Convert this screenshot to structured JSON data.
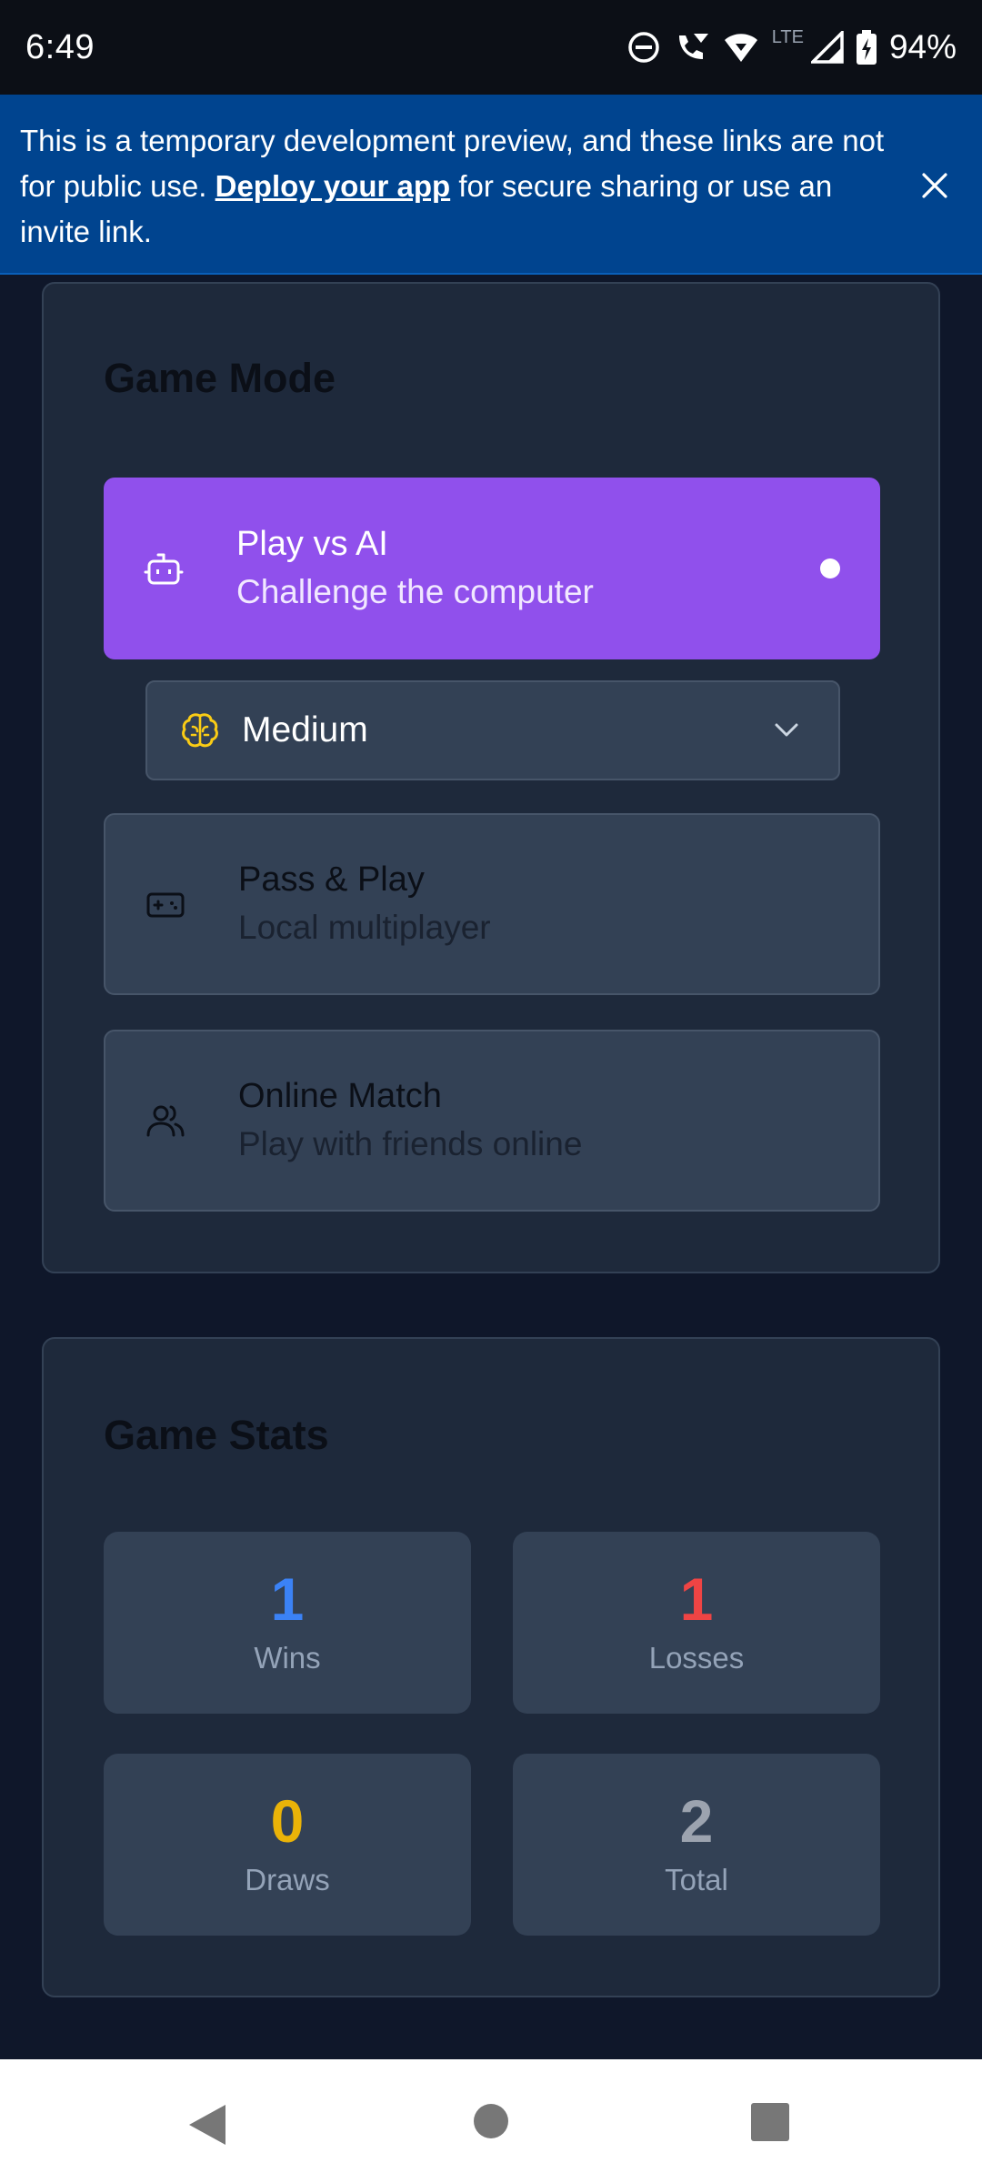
{
  "status_bar": {
    "time": "6:49",
    "network": "LTE",
    "battery": "94%"
  },
  "banner": {
    "text_before": "This is a temporary development preview, and these links are not for public use. ",
    "link": "Deploy your app",
    "text_after": " for secure sharing or use an invite link."
  },
  "game_mode": {
    "title": "Game Mode",
    "options": [
      {
        "title": "Play vs AI",
        "subtitle": "Challenge the computer",
        "icon": "robot-icon",
        "selected": true
      },
      {
        "title": "Pass & Play",
        "subtitle": "Local multiplayer",
        "icon": "gamepad-icon",
        "selected": false
      },
      {
        "title": "Online Match",
        "subtitle": "Play with friends online",
        "icon": "users-icon",
        "selected": false
      }
    ],
    "difficulty": {
      "value": "Medium",
      "icon": "brain-icon"
    }
  },
  "game_stats": {
    "title": "Game Stats",
    "stats": [
      {
        "value": "1",
        "label": "Wins",
        "color": "#3b82f6"
      },
      {
        "value": "1",
        "label": "Losses",
        "color": "#ef4444"
      },
      {
        "value": "0",
        "label": "Draws",
        "color": "#eab308"
      },
      {
        "value": "2",
        "label": "Total",
        "color": "#9ca3af"
      }
    ]
  },
  "colors": {
    "accent": "#9050ec",
    "banner": "#00448f",
    "background": "#0f172a",
    "card": "#1e293b"
  }
}
